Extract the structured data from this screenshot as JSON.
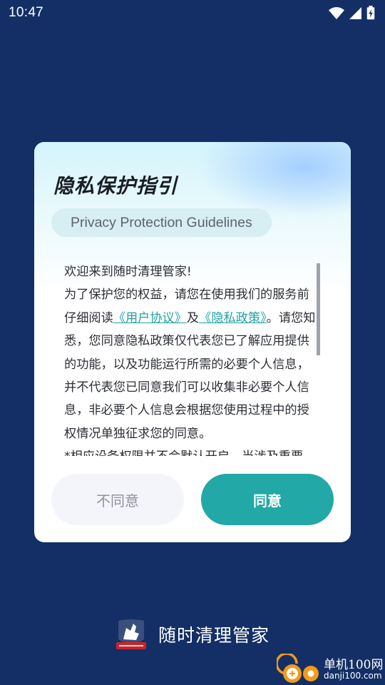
{
  "status_bar": {
    "time": "10:47",
    "icons": [
      "wifi-icon",
      "cellular-signal-icon",
      "battery-charging-icon"
    ]
  },
  "dialog": {
    "title": "隐私保护指引",
    "subtitle": "Privacy Protection Guidelines",
    "body": {
      "greeting": "欢迎来到随时清理管家!",
      "intro_prefix": "为了保护您的权益，请您在使用我们的服务前仔细阅读",
      "user_agreement_link": "《用户协议》",
      "and_text": "及",
      "privacy_policy_link": "《隐私政策》",
      "intro_suffix": "。请您知悉，您同意隐私政策仅代表您已了解应用提供的功能，以及功能运行所需的必要个人信息，并不代表您已同意我们可以收集非必要个人信息，非必要个人信息会根据您使用过程中的授权情况单独征求您的同意。",
      "permissions_note": "*相应设备权限并不会默认开启，当涉及重要"
    },
    "disagree_button": "不同意",
    "agree_button": "同意"
  },
  "brand": {
    "logo_caption": "随时清理管家",
    "app_name": "随时清理管家"
  },
  "watermark": {
    "title": "单机100网",
    "domain": "danji100.com"
  },
  "colors": {
    "background": "#132f66",
    "accent": "#22a8a6",
    "link": "#21a3a3"
  }
}
